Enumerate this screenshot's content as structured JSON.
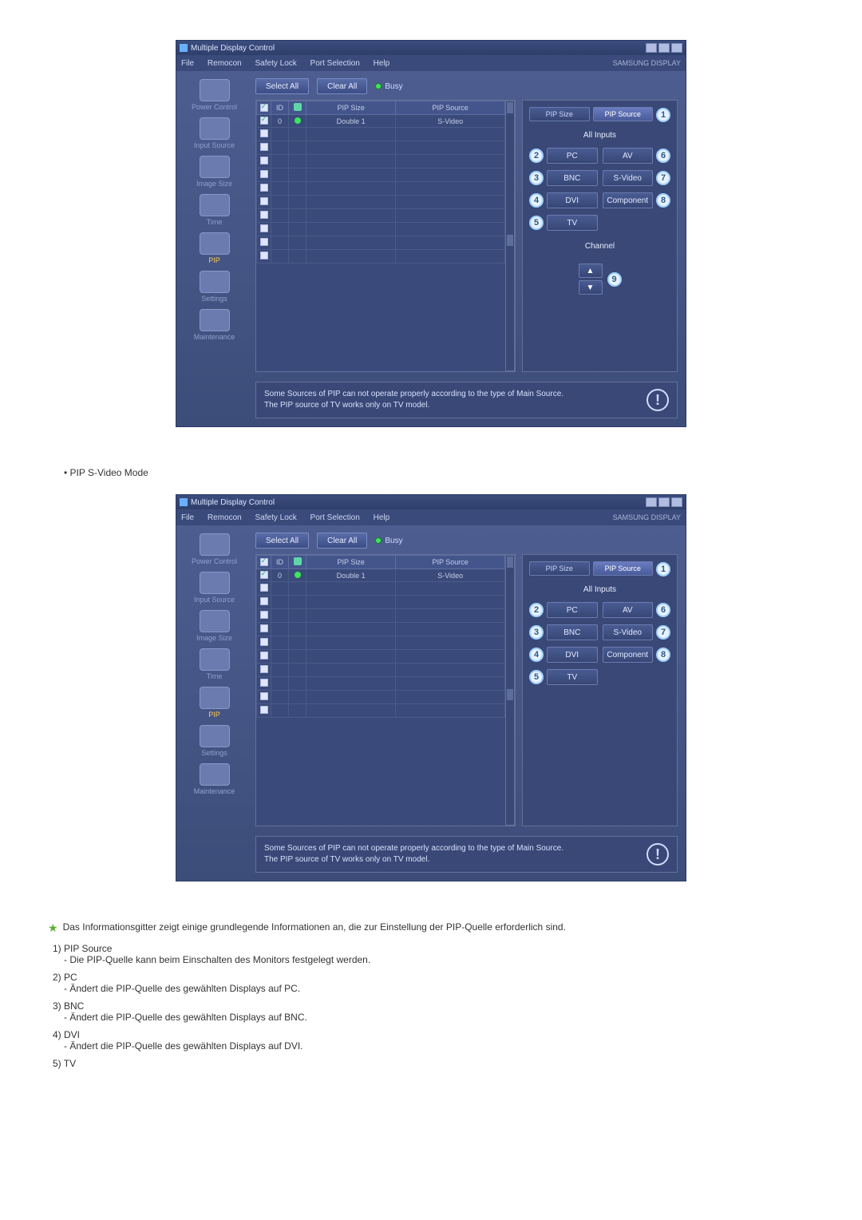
{
  "shared": {
    "title": "Multiple Display Control",
    "menu": {
      "file": "File",
      "remocon": "Remocon",
      "safety": "Safety Lock",
      "port": "Port Selection",
      "help": "Help"
    },
    "brand": "SAMSUNG DISPLAY",
    "buttons": {
      "select_all": "Select All",
      "clear_all": "Clear All",
      "busy": "Busy"
    },
    "sidebar": {
      "power": "Power Control",
      "input": "Input Source",
      "image": "Image Size",
      "time": "Time",
      "pip": "PIP",
      "settings": "Settings",
      "maintenance": "Maintenance"
    },
    "grid": {
      "h_chk": "",
      "h_id": "ID",
      "h_st": "",
      "h_size": "PIP Size",
      "h_source": "PIP Source",
      "row_id": "0",
      "row_size": "Double 1",
      "row_source": "S-Video"
    },
    "right": {
      "tab_size": "PIP Size",
      "tab_source": "PIP Source",
      "all_inputs": "All Inputs",
      "pc": "PC",
      "av": "AV",
      "bnc": "BNC",
      "svideo": "S-Video",
      "dvi": "DVI",
      "component": "Component",
      "tv": "TV",
      "channel": "Channel",
      "n1": "1",
      "n2": "2",
      "n3": "3",
      "n4": "4",
      "n5": "5",
      "n6": "6",
      "n7": "7",
      "n8": "8",
      "n9": "9",
      "up": "▲",
      "down": "▼"
    },
    "info1": "Some Sources of PIP can not operate properly according to the type of Main Source.",
    "info2": "The PIP source of TV works only on TV model."
  },
  "bullet_text": "• PIP S-Video Mode",
  "variant_b_show_channel": false,
  "notes": {
    "intro": "Das Informationsgitter zeigt einige grundlegende Informationen an, die zur Einstellung der PIP-Quelle erforderlich sind.",
    "n1_h": "1)  PIP Source",
    "n1_s": "- Die PIP-Quelle kann beim Einschalten des Monitors festgelegt werden.",
    "n2_h": "2)  PC",
    "n2_s": "- Ändert die PIP-Quelle des gewählten Displays auf PC.",
    "n3_h": "3)  BNC",
    "n3_s": "- Ändert die PIP-Quelle des gewählten Displays auf BNC.",
    "n4_h": "4)  DVI",
    "n4_s": "- Ändert die PIP-Quelle des gewählten Displays auf DVI.",
    "n5_h": "5)  TV"
  }
}
